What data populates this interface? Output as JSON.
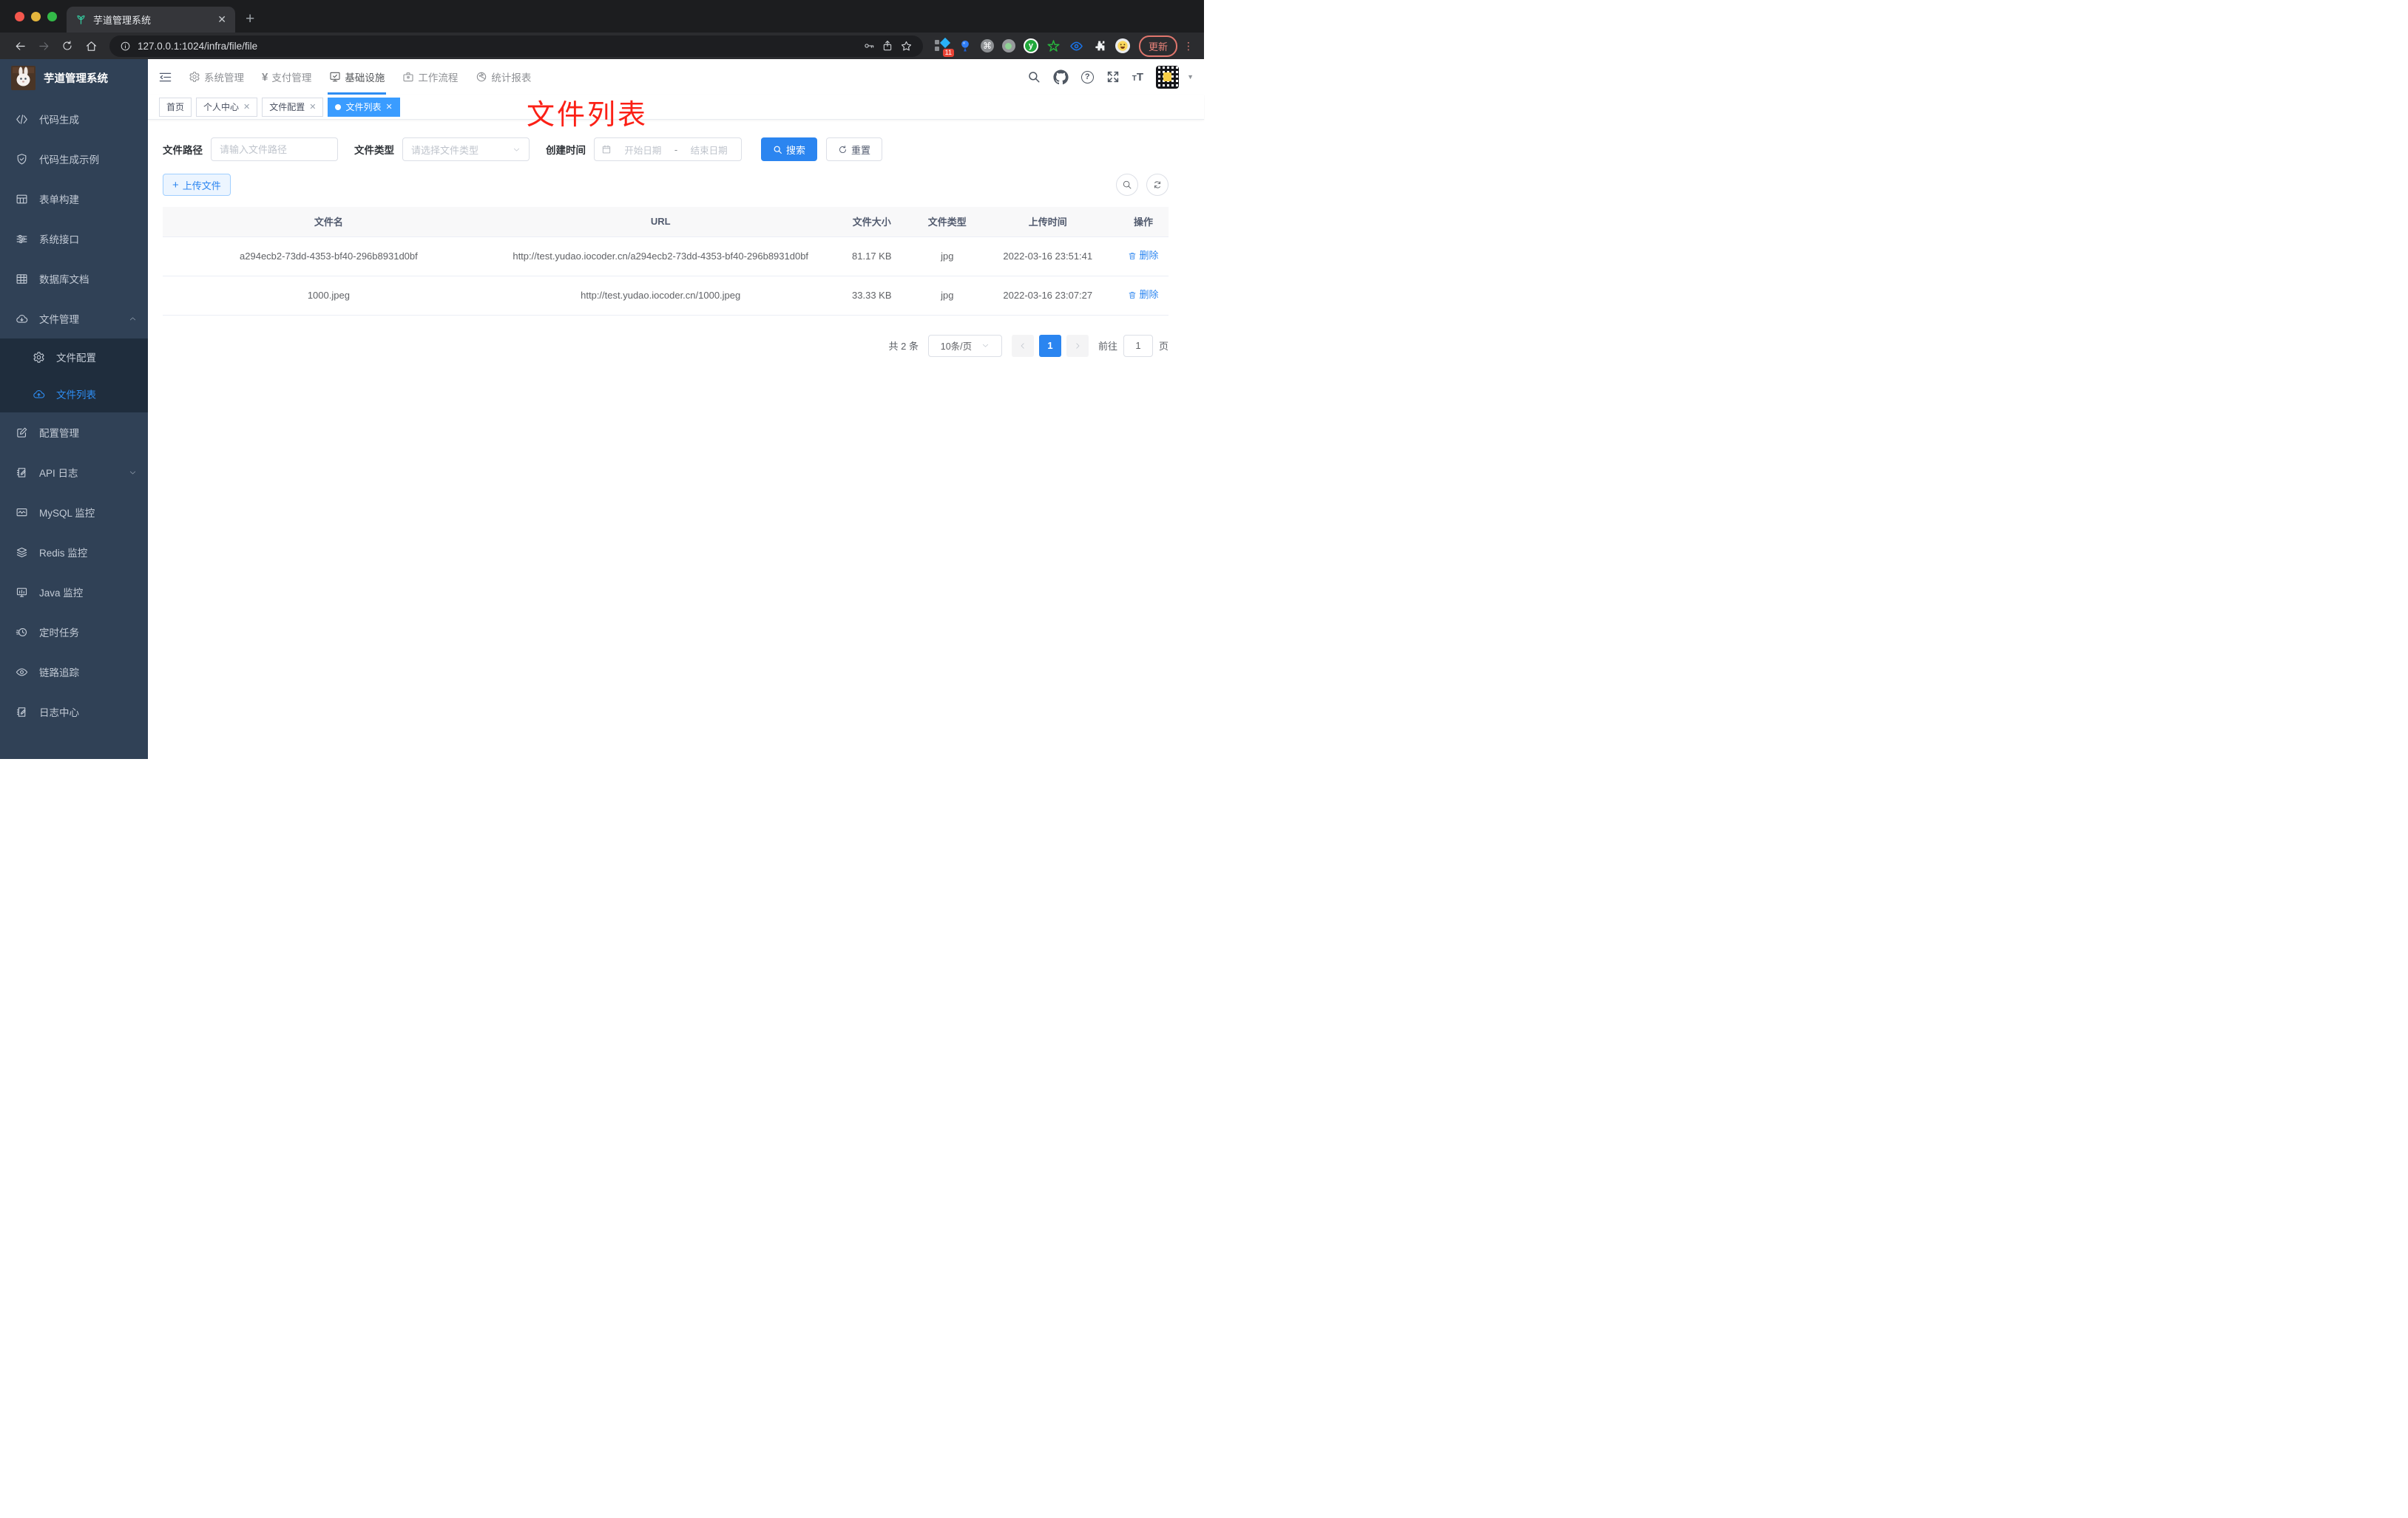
{
  "colors": {
    "accent": "#2b85f0",
    "sidebar_bg": "#304156",
    "submenu_bg": "#1f2d3d",
    "annotation_red": "#fb2016",
    "tag_active": "#3a9cff"
  },
  "browser": {
    "tab_title": "芋道管理系统",
    "url": "127.0.0.1:1024/infra/file/file",
    "ext_badge": "11",
    "update_label": "更新"
  },
  "header": {
    "nav_items": [
      {
        "label": "系统管理",
        "icon": "gear-icon",
        "active": false
      },
      {
        "label": "支付管理",
        "icon": "yen-icon",
        "active": false
      },
      {
        "label": "基础设施",
        "icon": "monitor-check-icon",
        "active": true
      },
      {
        "label": "工作流程",
        "icon": "briefcase-icon",
        "active": false
      },
      {
        "label": "统计报表",
        "icon": "chart-icon",
        "active": false
      }
    ]
  },
  "tags": {
    "items": [
      {
        "label": "首页",
        "closable": false,
        "active": false
      },
      {
        "label": "个人中心",
        "closable": true,
        "active": false
      },
      {
        "label": "文件配置",
        "closable": true,
        "active": false
      },
      {
        "label": "文件列表",
        "closable": true,
        "active": true
      }
    ]
  },
  "annotation": {
    "text": "文件列表"
  },
  "sidebar": {
    "logo_title": "芋道管理系统",
    "items": [
      {
        "label": "代码生成",
        "icon": "code-icon"
      },
      {
        "label": "代码生成示例",
        "icon": "shield-check-icon"
      },
      {
        "label": "表单构建",
        "icon": "form-grid-icon"
      },
      {
        "label": "系统接口",
        "icon": "sliders-icon"
      },
      {
        "label": "数据库文档",
        "icon": "table-icon"
      },
      {
        "label": "文件管理",
        "icon": "cloud-download-icon",
        "expanded": true
      },
      {
        "label": "文件配置",
        "icon": "gear-icon",
        "submenu": true
      },
      {
        "label": "文件列表",
        "icon": "cloud-upload-icon",
        "submenu": true,
        "active": true
      },
      {
        "label": "配置管理",
        "icon": "edit-icon"
      },
      {
        "label": "API 日志",
        "icon": "log-icon",
        "collapsed": true
      },
      {
        "label": "MySQL 监控",
        "icon": "monitor-wave-icon"
      },
      {
        "label": "Redis 监控",
        "icon": "layers-icon"
      },
      {
        "label": "Java 监控",
        "icon": "monitor-bars-icon"
      },
      {
        "label": "定时任务",
        "icon": "timer-icon"
      },
      {
        "label": "链路追踪",
        "icon": "eye-icon"
      },
      {
        "label": "日志中心",
        "icon": "log-icon"
      }
    ]
  },
  "filters": {
    "path_label": "文件路径",
    "path_placeholder": "请输入文件路径",
    "type_label": "文件类型",
    "type_placeholder": "请选择文件类型",
    "date_label": "创建时间",
    "date_start_placeholder": "开始日期",
    "date_separator": "-",
    "date_end_placeholder": "结束日期",
    "search_label": "搜索",
    "reset_label": "重置"
  },
  "toolbar": {
    "upload_label": "上传文件"
  },
  "table": {
    "columns": [
      "文件名",
      "URL",
      "文件大小",
      "文件类型",
      "上传时间",
      "操作"
    ],
    "rows": [
      {
        "name": "a294ecb2-73dd-4353-bf40-296b8931d0bf",
        "url": "http://test.yudao.iocoder.cn/a294ecb2-73dd-4353-bf40-296b8931d0bf",
        "size": "81.17 KB",
        "type": "jpg",
        "time": "2022-03-16 23:51:41",
        "action": "删除"
      },
      {
        "name": "1000.jpeg",
        "url": "http://test.yudao.iocoder.cn/1000.jpeg",
        "size": "33.33 KB",
        "type": "jpg",
        "time": "2022-03-16 23:07:27",
        "action": "删除"
      }
    ]
  },
  "pagination": {
    "total": "共 2 条",
    "page_size": "10条/页",
    "current_page": "1",
    "goto_label": "前往",
    "goto_value": "1",
    "page_unit": "页"
  }
}
